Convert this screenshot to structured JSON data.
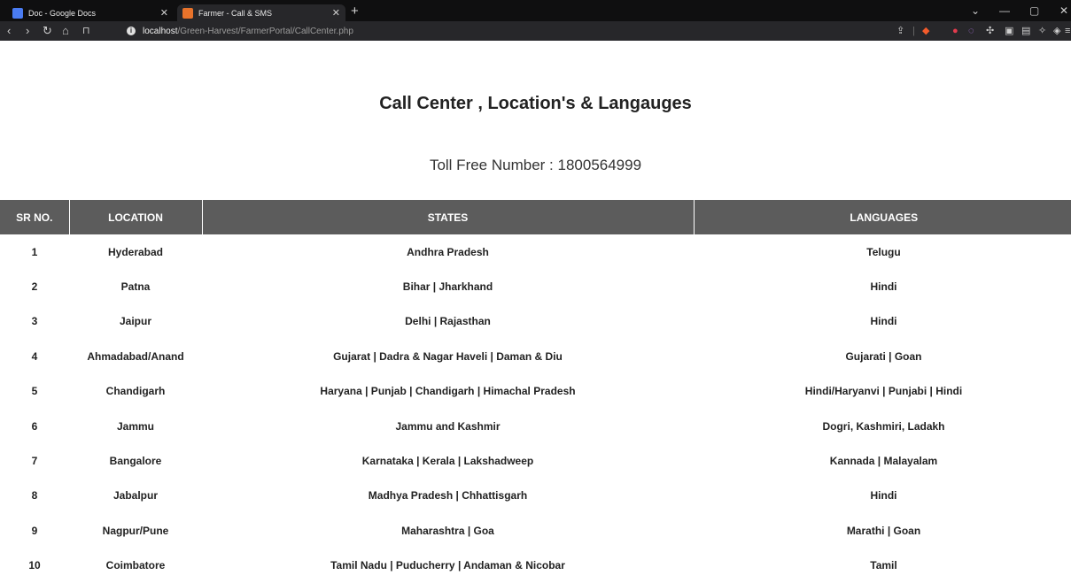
{
  "browser": {
    "tabs": [
      {
        "label": "Doc - Google Docs",
        "icon": "google-docs-icon",
        "color": "#4a7cf3"
      },
      {
        "label": "Farmer - Call & SMS",
        "icon": "site-favicon",
        "color": "#e8732b"
      }
    ],
    "url_host": "localhost",
    "url_path": "/Green-Harvest/FarmerPortal/CallCenter.php"
  },
  "page": {
    "title": "Call Center , Location's & Langauges",
    "toll_free": "Toll Free Number : 1800564999"
  },
  "table": {
    "headers": [
      "SR NO.",
      "LOCATION",
      "STATES",
      "LANGUAGES"
    ],
    "rows": [
      [
        "1",
        "Hyderabad",
        "Andhra Pradesh",
        "Telugu"
      ],
      [
        "2",
        "Patna",
        "Bihar | Jharkhand",
        "Hindi"
      ],
      [
        "3",
        "Jaipur",
        "Delhi | Rajasthan",
        "Hindi"
      ],
      [
        "4",
        "Ahmadabad/Anand",
        "Gujarat | Dadra & Nagar Haveli | Daman & Diu",
        "Gujarati | Goan"
      ],
      [
        "5",
        "Chandigarh",
        "Haryana | Punjab | Chandigarh | Himachal Pradesh",
        "Hindi/Haryanvi | Punjabi | Hindi"
      ],
      [
        "6",
        "Jammu",
        "Jammu and Kashmir",
        "Dogri, Kashmiri, Ladakh"
      ],
      [
        "7",
        "Bangalore",
        "Karnataka | Kerala | Lakshadweep",
        "Kannada | Malayalam"
      ],
      [
        "8",
        "Jabalpur",
        "Madhya Pradesh | Chhattisgarh",
        "Hindi"
      ],
      [
        "9",
        "Nagpur/Pune",
        "Maharashtra | Goa",
        "Marathi | Goan"
      ],
      [
        "10",
        "Coimbatore",
        "Tamil Nadu | Puducherry | Andaman & Nicobar",
        "Tamil"
      ]
    ]
  },
  "colors": {
    "header_bg": "#5c5c5c",
    "chrome_dark": "#0f0f10",
    "toolbar": "#27272a"
  }
}
